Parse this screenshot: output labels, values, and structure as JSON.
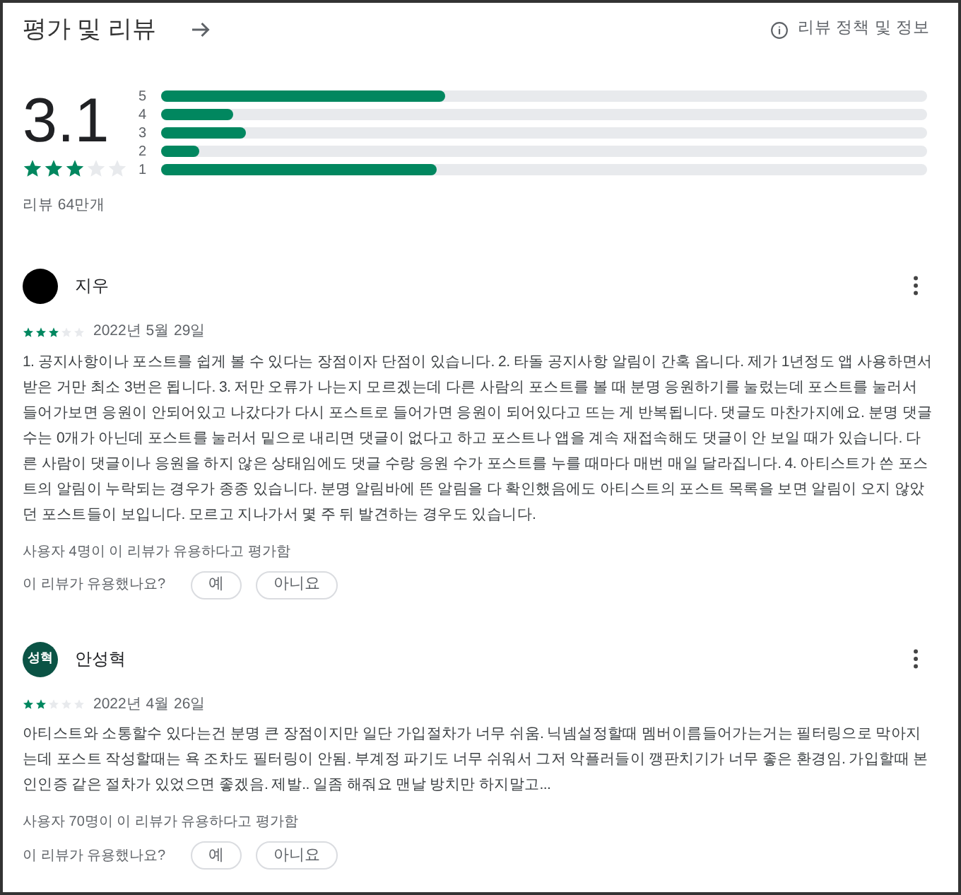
{
  "header": {
    "title": "평가 및 리뷰",
    "policy_link": "리뷰 정책 및 정보"
  },
  "summary": {
    "score": "3.1",
    "stars": 3,
    "review_count": "리뷰 64만개",
    "distribution": [
      {
        "label": "5",
        "level": 0.37
      },
      {
        "label": "4",
        "level": 0.095
      },
      {
        "label": "3",
        "level": 0.11
      },
      {
        "label": "2",
        "level": 0.05
      },
      {
        "label": "1",
        "level": 0.36
      }
    ]
  },
  "reviews": [
    {
      "author": "지우",
      "stars": 3,
      "date": "2022년 5월 29일",
      "text": "1. 공지사항이나 포스트를 쉽게 볼 수 있다는 장점이자 단점이 있습니다. 2. 타돌 공지사항 알림이 간혹 옵니다. 제가 1년정도 앱 사용하면서 받은 거만 최소 3번은 됩니다. 3. 저만 오류가 나는지 모르겠는데 다른 사람의 포스트를 볼 때 분명 응원하기를 눌렀는데 포스트를 눌러서 들어가보면 응원이 안되어있고 나갔다가 다시 포스트로 들어가면 응원이 되어있다고 뜨는 게 반복됩니다. 댓글도 마찬가지에요. 분명 댓글 수는 0개가 아닌데 포스트를 눌러서 밑으로 내리면 댓글이 없다고 하고 포스트나 앱을 계속 재접속해도 댓글이 안 보일 때가 있습니다. 다른 사람이 댓글이나 응원을 하지 않은 상태임에도 댓글 수랑 응원 수가 포스트를 누를 때마다 매번 매일 달라집니다. 4. 아티스트가 쓴 포스트의 알림이 누락되는 경우가 종종 있습니다. 분명 알림바에 뜬 알림을 다 확인했음에도 아티스트의 포스트 목록을 보면 알림이 오지 않았던 포스트들이 보입니다. 모르고 지나가서 몇 주 뒤 발견하는 경우도 있습니다.",
      "helpful_count": "사용자 4명이 이 리뷰가 유용하다고 평가함",
      "helpful_question": "이 리뷰가 유용했나요?",
      "buttons": [
        "예",
        "아니요"
      ]
    },
    {
      "author": "안성혁",
      "avatar_text": "성혁",
      "stars": 2,
      "date": "2022년 4월 26일",
      "text": "아티스트와 소통할수 있다는건 분명 큰 장점이지만 일단 가입절차가 너무 쉬움. 닉넴설정할때 멤버이름들어가는거는 필터링으로 막아지는데 포스트 작성할때는 욕 조차도 필터링이 안됨. 부계정 파기도 너무 쉬워서 그저 악플러들이 깽판치기가 너무 좋은 환경임. 가입할때 본인인증 같은 절차가 있었으면 좋겠음. 제발.. 일좀 해줘요 맨날 방치만 하지말고...",
      "helpful_count": "사용자 70명이 이 리뷰가 유용하다고 평가함",
      "helpful_question": "이 리뷰가 유용했나요?",
      "buttons": [
        "예",
        "아니요"
      ]
    }
  ]
}
